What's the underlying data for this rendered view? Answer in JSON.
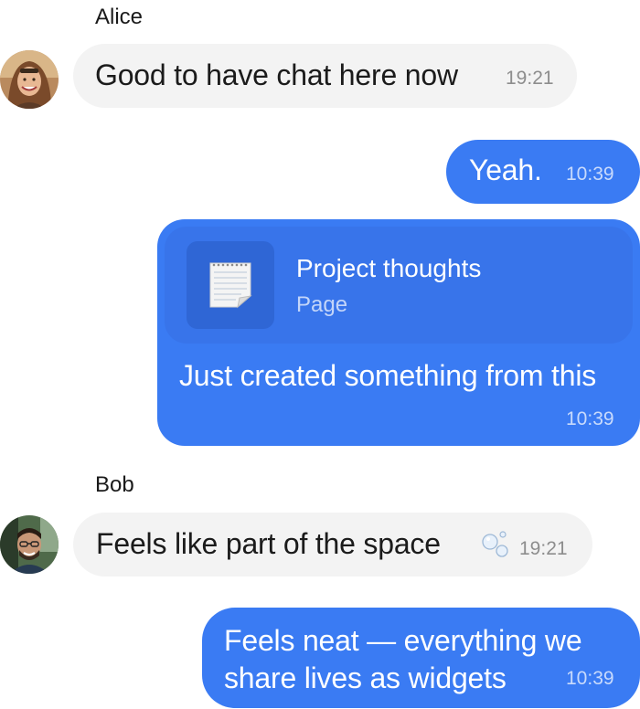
{
  "messages": [
    {
      "sender": "Alice",
      "text": "Good to have chat here now",
      "time": "19:21",
      "direction": "incoming",
      "avatar_icon": "alice-avatar"
    },
    {
      "text": "Yeah.",
      "time": "10:39",
      "direction": "outgoing"
    },
    {
      "card": {
        "title": "Project thoughts",
        "subtitle": "Page",
        "icon": "notepad-icon"
      },
      "text": "Just created something from this",
      "time": "10:39",
      "direction": "outgoing"
    },
    {
      "sender": "Bob",
      "text": "Feels like part of the space",
      "emoji_icon": "bubbles-icon",
      "time": "19:21",
      "direction": "incoming",
      "avatar_icon": "bob-avatar"
    },
    {
      "text": "Feels neat — everything we share lives as widgets",
      "time": "10:39",
      "direction": "outgoing"
    }
  ],
  "colors": {
    "outgoing_bubble": "#3a7bf3",
    "incoming_bubble": "#f3f3f3",
    "card_bg": "#3874ea"
  }
}
